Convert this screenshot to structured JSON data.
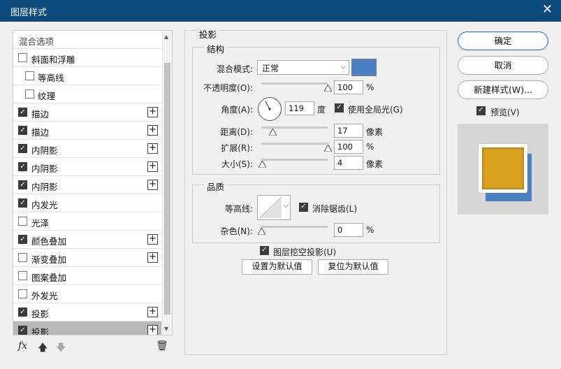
{
  "window": {
    "title": "图层样式",
    "close_glyph": "✕"
  },
  "styles_list": {
    "header": "混合选项",
    "items": [
      {
        "label": "斜面和浮雕",
        "checked": false,
        "indent": false,
        "plus": false,
        "selected": false
      },
      {
        "label": "等高线",
        "checked": false,
        "indent": true,
        "plus": false,
        "selected": false
      },
      {
        "label": "纹理",
        "checked": false,
        "indent": true,
        "plus": false,
        "selected": false
      },
      {
        "label": "描边",
        "checked": true,
        "indent": false,
        "plus": true,
        "selected": false
      },
      {
        "label": "描边",
        "checked": true,
        "indent": false,
        "plus": true,
        "selected": false
      },
      {
        "label": "内阴影",
        "checked": true,
        "indent": false,
        "plus": true,
        "selected": false
      },
      {
        "label": "内阴影",
        "checked": true,
        "indent": false,
        "plus": true,
        "selected": false
      },
      {
        "label": "内阴影",
        "checked": true,
        "indent": false,
        "plus": true,
        "selected": false
      },
      {
        "label": "内发光",
        "checked": true,
        "indent": false,
        "plus": false,
        "selected": false
      },
      {
        "label": "光泽",
        "checked": false,
        "indent": false,
        "plus": false,
        "selected": false
      },
      {
        "label": "颜色叠加",
        "checked": true,
        "indent": false,
        "plus": true,
        "selected": false
      },
      {
        "label": "渐变叠加",
        "checked": false,
        "indent": false,
        "plus": true,
        "selected": false
      },
      {
        "label": "图案叠加",
        "checked": false,
        "indent": false,
        "plus": false,
        "selected": false
      },
      {
        "label": "外发光",
        "checked": false,
        "indent": false,
        "plus": false,
        "selected": false
      },
      {
        "label": "投影",
        "checked": true,
        "indent": false,
        "plus": true,
        "selected": false
      },
      {
        "label": "投影",
        "checked": true,
        "indent": false,
        "plus": true,
        "selected": true
      }
    ],
    "tools": {
      "fx": "fx",
      "up": "🡅",
      "down": "🡇",
      "trash": "🗑"
    }
  },
  "drop_shadow": {
    "section_title": "投影",
    "structure": {
      "title": "结构",
      "blend_mode_label": "混合模式:",
      "blend_mode_value": "正常",
      "swatch_color": "#4a80c4",
      "opacity_label": "不透明度(O):",
      "opacity_value": "100",
      "opacity_unit": "%",
      "opacity_level": 1.0,
      "angle_label": "角度(A):",
      "angle_value": "119",
      "angle_unit": "度",
      "global_light_label": "使用全局光(G)",
      "global_light_checked": true,
      "distance_label": "距离(D):",
      "distance_value": "17",
      "distance_unit": "像素",
      "distance_level": 0.17,
      "spread_label": "扩展(R):",
      "spread_value": "100",
      "spread_unit": "%",
      "spread_level": 1.0,
      "size_label": "大小(S):",
      "size_value": "4",
      "size_unit": "像素",
      "size_level": 0.02
    },
    "quality": {
      "title": "品质",
      "contour_label": "等高线:",
      "anti_alias_label": "消除锯齿(L)",
      "anti_alias_checked": true,
      "noise_label": "杂色(N):",
      "noise_value": "0",
      "noise_unit": "%",
      "noise_level": 0.0
    },
    "knockout_label": "图层挖空投影(U)",
    "knockout_checked": true,
    "set_default": "设置为默认值",
    "reset_default": "复位为默认值"
  },
  "actions": {
    "ok": "确定",
    "cancel": "取消",
    "new_style": "新建样式(W)...",
    "preview_label": "预览(V)",
    "preview_checked": true,
    "preview_fill": "#d9a21e",
    "preview_shadow": "#4a80c4"
  }
}
